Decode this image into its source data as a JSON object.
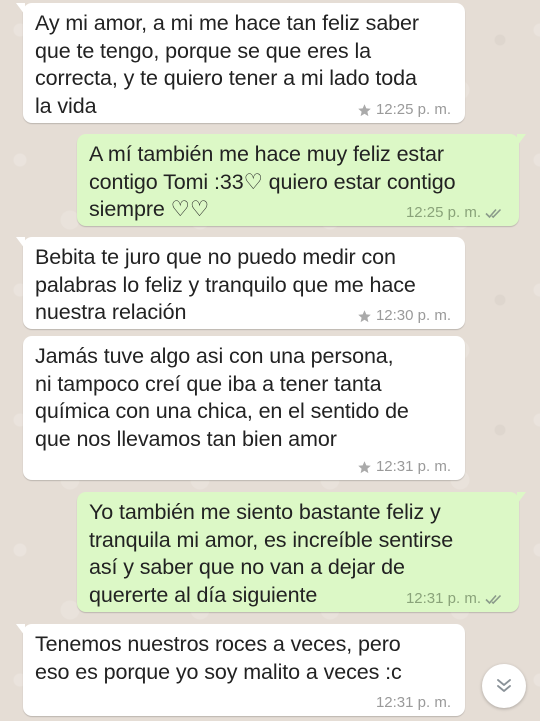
{
  "colors": {
    "wallpaper": "#e5ddd5",
    "incoming_bubble": "#ffffff",
    "outgoing_bubble": "#dcf8c6",
    "timestamp": "#9a9a9a",
    "read_ticks": "#8aa37a"
  },
  "messages": [
    {
      "direction": "incoming",
      "text": "Ay mi amor, a mi me hace tan feliz saber\nque te tengo, porque se que eres la\ncorrecta, y te quiero tener a mi lado toda\nla vida",
      "time": "12:25 p. m.",
      "starred": true,
      "status_icon": "none"
    },
    {
      "direction": "outgoing",
      "text": "A mí también me hace muy feliz estar\ncontigo Tomi :33♡ quiero estar contigo\nsiempre ♡♡",
      "time": "12:25 p. m.",
      "starred": false,
      "status_icon": "double-check-icon"
    },
    {
      "direction": "incoming",
      "text": "Bebita te juro que no puedo medir con\npalabras lo feliz y tranquilo que me hace\nnuestra relación",
      "time": "12:30 p. m.",
      "starred": true,
      "status_icon": "none"
    },
    {
      "direction": "incoming",
      "text": "Jamás tuve algo asi con una persona,\nni tampoco creí que iba a tener tanta\nquímica con una chica, en el sentido de\nque nos llevamos tan bien amor",
      "time": "12:31 p. m.",
      "starred": true,
      "status_icon": "none"
    },
    {
      "direction": "outgoing",
      "text": "Yo también me siento bastante feliz y\ntranquila mi amor, es increíble sentirse\nasí y saber que no van a dejar de\nquererte al día siguiente",
      "time": "12:31 p. m.",
      "starred": false,
      "status_icon": "double-check-icon"
    },
    {
      "direction": "incoming",
      "text": "Tenemos nuestros roces a veces, pero\neso es porque yo soy malito a veces :c",
      "time": "12:31 p. m.",
      "starred": false,
      "status_icon": "none"
    }
  ],
  "scroll_button": {
    "icon": "double-chevron-down-icon"
  }
}
